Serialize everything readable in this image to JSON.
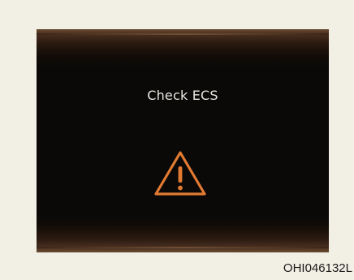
{
  "display": {
    "message": "Check ECS",
    "warning_icon": "warning-triangle-icon",
    "icon_color": "#e27a32",
    "text_color": "#e8e6e0",
    "background_color": "#0a0908"
  },
  "figure": {
    "code": "OHI046132L",
    "page_background": "#f2efe4"
  }
}
